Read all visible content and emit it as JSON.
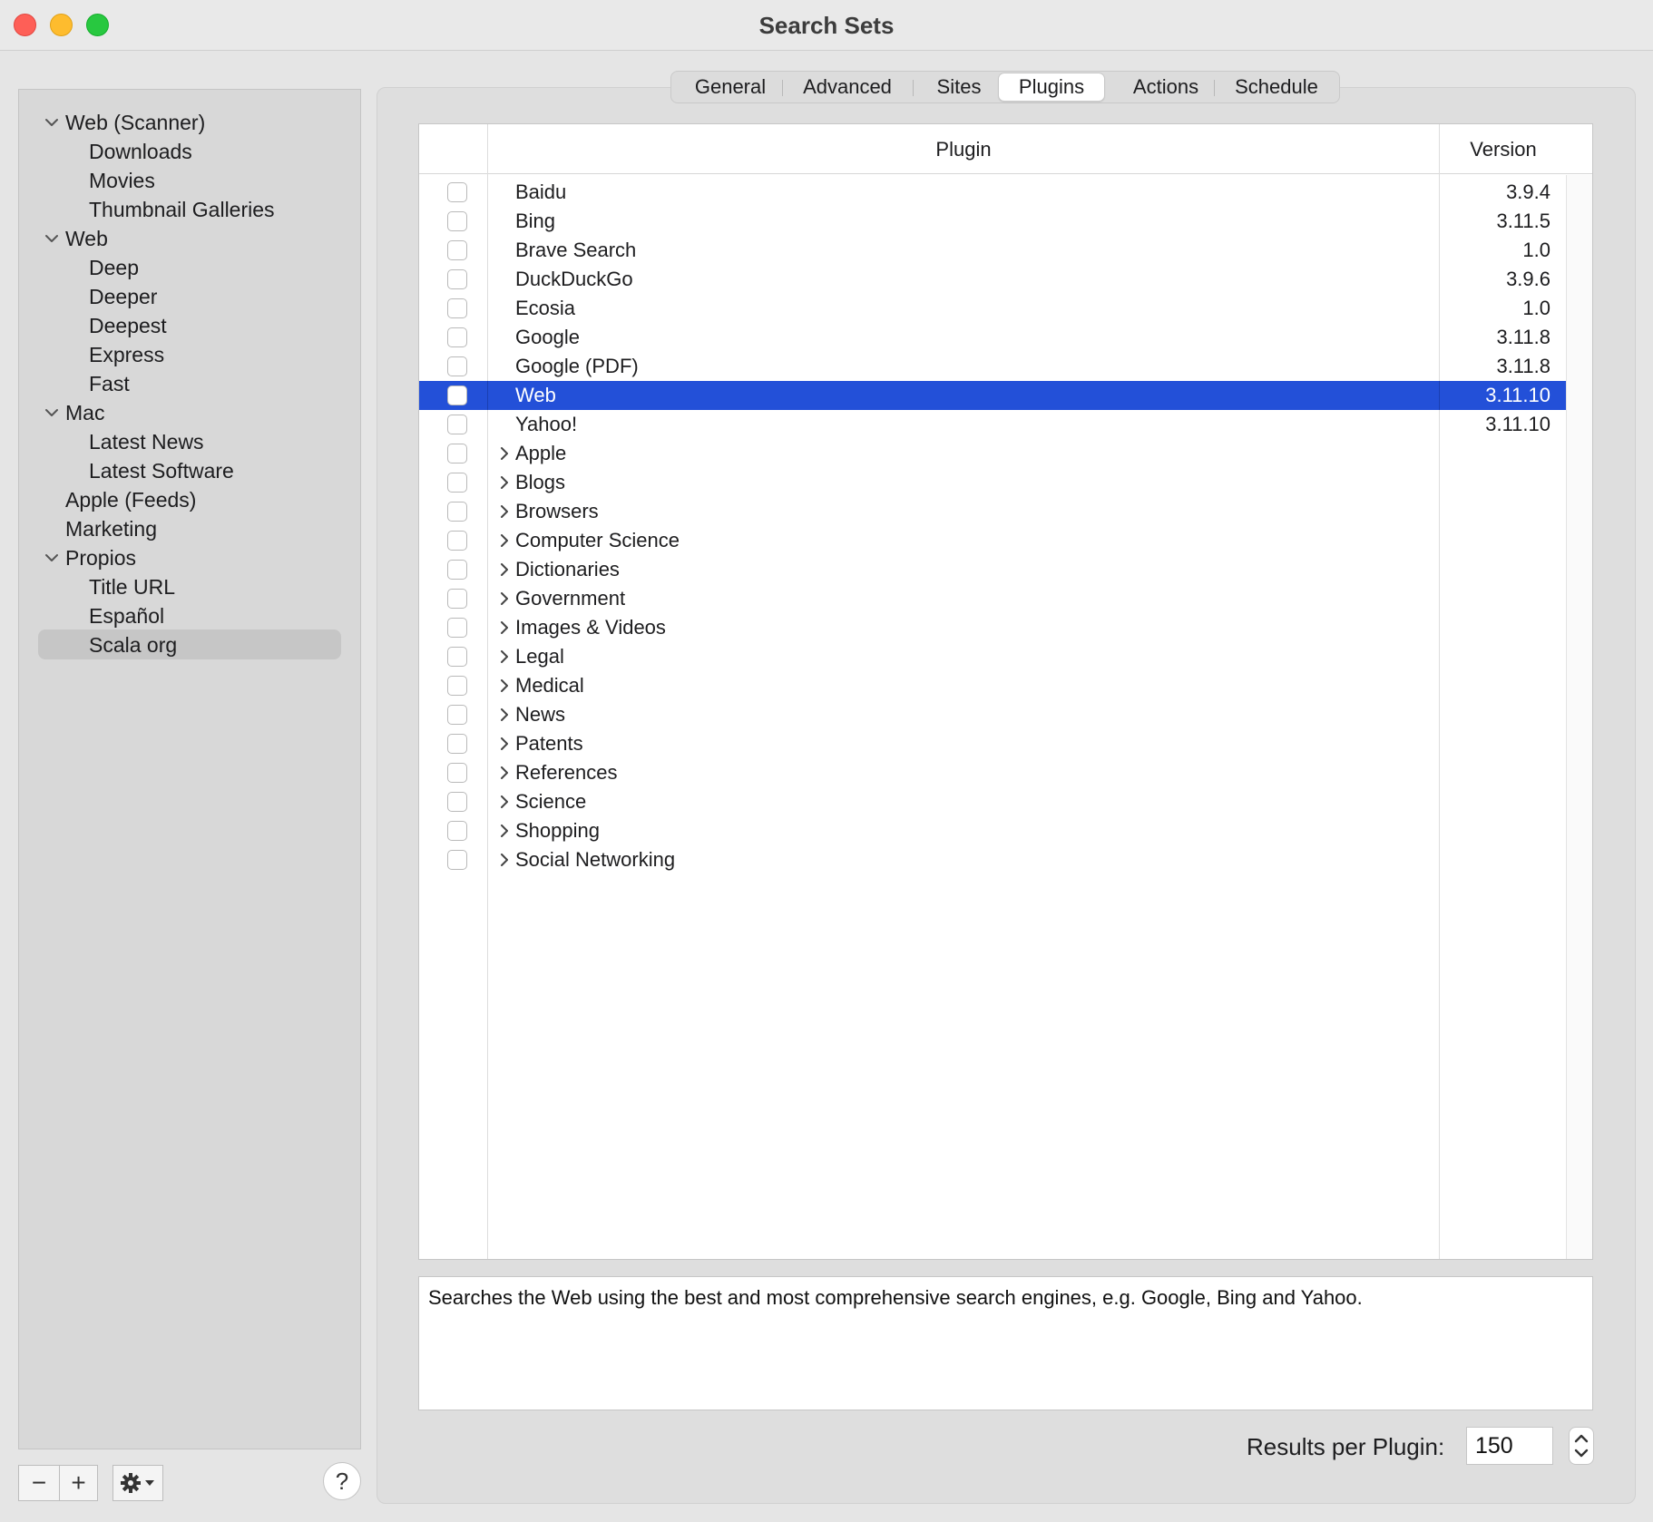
{
  "window": {
    "title": "Search Sets"
  },
  "sidebar": {
    "items": [
      {
        "label": "Web (Scanner)",
        "level": 0,
        "expanded": true
      },
      {
        "label": "Downloads",
        "level": 1
      },
      {
        "label": "Movies",
        "level": 1
      },
      {
        "label": "Thumbnail Galleries",
        "level": 1
      },
      {
        "label": "Web",
        "level": 0,
        "expanded": true
      },
      {
        "label": "Deep",
        "level": 1
      },
      {
        "label": "Deeper",
        "level": 1
      },
      {
        "label": "Deepest",
        "level": 1
      },
      {
        "label": "Express",
        "level": 1
      },
      {
        "label": "Fast",
        "level": 1
      },
      {
        "label": "Mac",
        "level": 0,
        "expanded": true
      },
      {
        "label": "Latest News",
        "level": 1
      },
      {
        "label": "Latest Software",
        "level": 1
      },
      {
        "label": "Apple (Feeds)",
        "level": 0
      },
      {
        "label": "Marketing",
        "level": 0
      },
      {
        "label": "Propios",
        "level": 0,
        "expanded": true
      },
      {
        "label": "Title URL",
        "level": 1
      },
      {
        "label": "Español",
        "level": 1
      },
      {
        "label": "Scala org",
        "level": 1,
        "selected": true
      }
    ],
    "buttons": {
      "remove": "−",
      "add": "+",
      "help": "?"
    }
  },
  "tabs": [
    {
      "label": "General"
    },
    {
      "label": "Advanced"
    },
    {
      "label": "Sites"
    },
    {
      "label": "Plugins",
      "active": true
    },
    {
      "label": "Actions"
    },
    {
      "label": "Schedule"
    }
  ],
  "table": {
    "headers": {
      "plugin": "Plugin",
      "version": "Version"
    },
    "rows": [
      {
        "name": "Baidu",
        "version": "3.9.4"
      },
      {
        "name": "Bing",
        "version": "3.11.5"
      },
      {
        "name": "Brave Search",
        "version": "1.0"
      },
      {
        "name": "DuckDuckGo",
        "version": "3.9.6"
      },
      {
        "name": "Ecosia",
        "version": "1.0"
      },
      {
        "name": "Google",
        "version": "3.11.8"
      },
      {
        "name": "Google (PDF)",
        "version": "3.11.8"
      },
      {
        "name": "Web",
        "version": "3.11.10",
        "selected": true
      },
      {
        "name": "Yahoo!",
        "version": "3.11.10"
      },
      {
        "name": "Apple",
        "group": true
      },
      {
        "name": "Blogs",
        "group": true
      },
      {
        "name": "Browsers",
        "group": true
      },
      {
        "name": "Computer Science",
        "group": true
      },
      {
        "name": "Dictionaries",
        "group": true
      },
      {
        "name": "Government",
        "group": true
      },
      {
        "name": "Images & Videos",
        "group": true
      },
      {
        "name": "Legal",
        "group": true
      },
      {
        "name": "Medical",
        "group": true
      },
      {
        "name": "News",
        "group": true
      },
      {
        "name": "Patents",
        "group": true
      },
      {
        "name": "References",
        "group": true
      },
      {
        "name": "Science",
        "group": true
      },
      {
        "name": "Shopping",
        "group": true
      },
      {
        "name": "Social Networking",
        "group": true
      }
    ]
  },
  "description": "Searches the Web using the best and most comprehensive search engines, e.g. Google, Bing and Yahoo.",
  "results_per_plugin": {
    "label": "Results per Plugin:",
    "value": "150"
  },
  "colors": {
    "selection": "#2350d8",
    "sidebar_selection": "#c6c6c6"
  }
}
